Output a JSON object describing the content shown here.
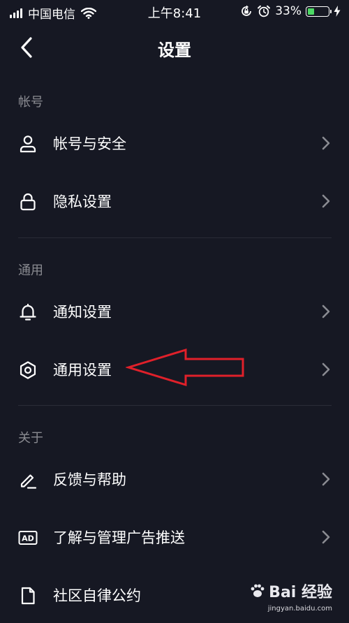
{
  "status_bar": {
    "carrier": "中国电信",
    "time": "上午8:41",
    "battery_percent": "33%",
    "battery_level": 0.33
  },
  "header": {
    "title": "设置"
  },
  "sections": [
    {
      "title": "帐号",
      "items": [
        {
          "label": "帐号与安全",
          "icon": "user-icon"
        },
        {
          "label": "隐私设置",
          "icon": "lock-icon"
        }
      ]
    },
    {
      "title": "通用",
      "items": [
        {
          "label": "通知设置",
          "icon": "bell-icon"
        },
        {
          "label": "通用设置",
          "icon": "gear-icon"
        }
      ]
    },
    {
      "title": "关于",
      "items": [
        {
          "label": "反馈与帮助",
          "icon": "pencil-icon"
        },
        {
          "label": "了解与管理广告推送",
          "icon": "ad-icon"
        },
        {
          "label": "社区自律公约",
          "icon": "document-icon"
        }
      ]
    }
  ],
  "icons": {
    "ad_badge": "AD"
  },
  "watermark": {
    "logo": "Bai 经验",
    "url": "jingyan.baidu.com"
  },
  "colors": {
    "background": "#161823",
    "section_header": "#8a8b91",
    "annotation": "#e0202a",
    "battery": "#4cd964"
  }
}
